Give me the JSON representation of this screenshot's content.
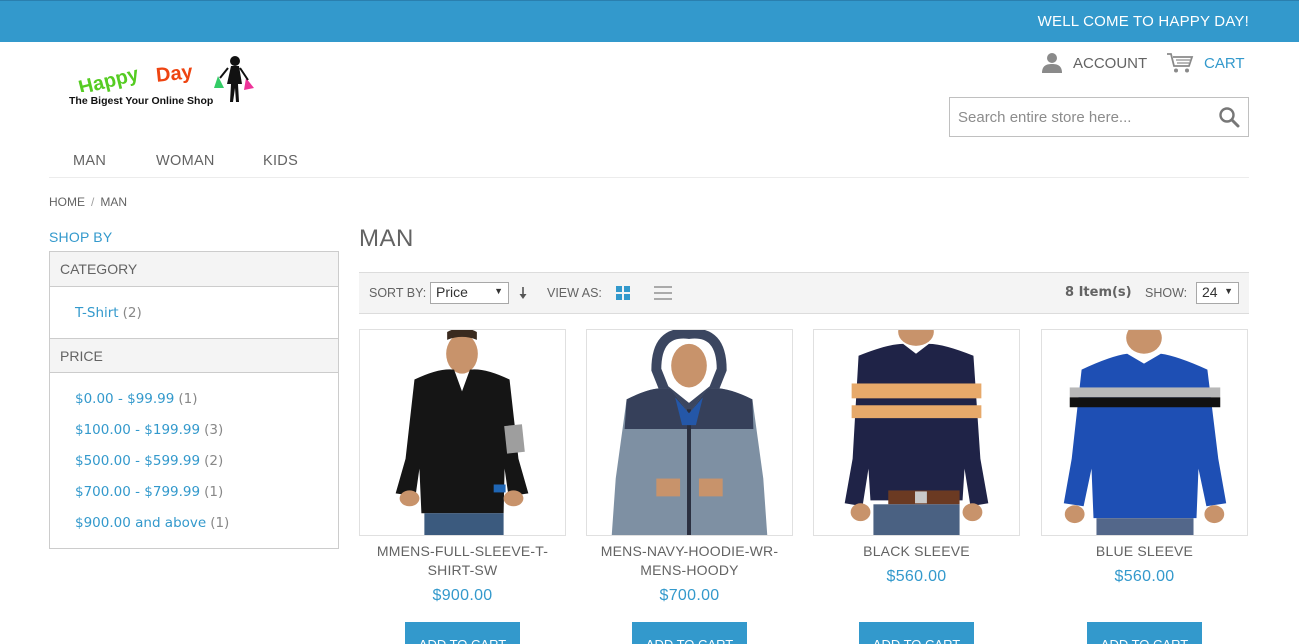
{
  "topbar": {
    "welcome": "WELL COME TO HAPPY DAY!"
  },
  "logo": {
    "brand": "Happy Day",
    "tagline": "The Bigest Your Online Shop"
  },
  "header": {
    "account_label": "ACCOUNT",
    "cart_label": "CART"
  },
  "search": {
    "placeholder": "Search entire store here..."
  },
  "nav": {
    "items": [
      "MAN",
      "WOMAN",
      "KIDS"
    ]
  },
  "breadcrumb": {
    "home": "HOME",
    "separator": "/",
    "current": "MAN"
  },
  "sidebar": {
    "title": "SHOP BY",
    "category": {
      "heading": "CATEGORY",
      "options": [
        {
          "label": "T-Shirt",
          "count": "(2)"
        }
      ]
    },
    "price": {
      "heading": "PRICE",
      "options": [
        {
          "label": "$0.00 - $99.99",
          "count": "(1)"
        },
        {
          "label": "$100.00 - $199.99",
          "count": "(3)"
        },
        {
          "label": "$500.00 - $599.99",
          "count": "(2)"
        },
        {
          "label": "$700.00 - $799.99",
          "count": "(1)"
        },
        {
          "label": "$900.00 and above",
          "count": "(1)"
        }
      ]
    }
  },
  "main": {
    "title": "MAN",
    "toolbar": {
      "sort_label": "SORT BY:",
      "sort_value": "Price",
      "view_label": "VIEW AS:",
      "items_count": "8 Item(s)",
      "show_label": "SHOW:",
      "show_value": "24"
    },
    "products": [
      {
        "name": "MMENS-FULL-SLEEVE-T-SHIRT-SW",
        "price": "$900.00",
        "button": "ADD TO CART"
      },
      {
        "name": "MENS-NAVY-HOODIE-WR-MENS-HOODY",
        "price": "$700.00",
        "button": "ADD TO CART"
      },
      {
        "name": "BLACK SLEEVE",
        "price": "$560.00",
        "button": "ADD TO CART"
      },
      {
        "name": "BLUE SLEEVE",
        "price": "$560.00",
        "button": "ADD TO CART"
      }
    ]
  },
  "colors": {
    "accent": "#3399cc",
    "text": "#636363",
    "panel": "#f4f4f4"
  },
  "icons": [
    "user-icon",
    "cart-icon",
    "search-icon",
    "sort-arrow-icon",
    "grid-view-icon",
    "list-view-icon"
  ]
}
